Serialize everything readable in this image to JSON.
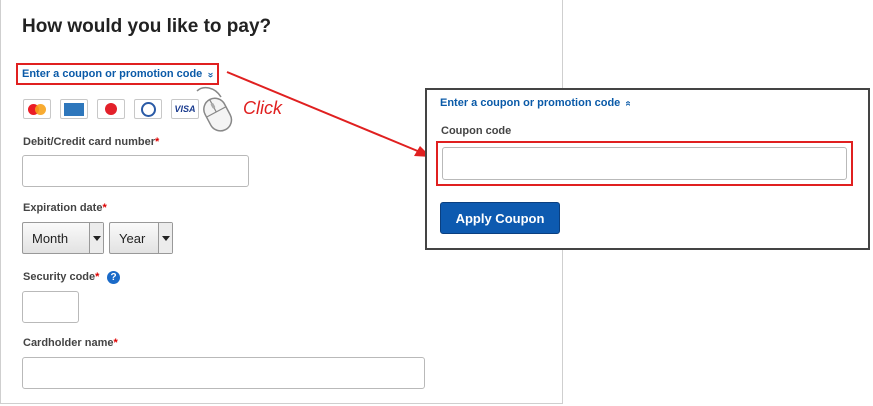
{
  "payment": {
    "title": "How would you like to pay?",
    "coupon_link": "Enter a coupon or promotion code",
    "coupon_chevron": "»",
    "card_icons": [
      "mastercard-icon",
      "amex-icon",
      "jcb-icon",
      "diners-club-icon",
      "visa-icon"
    ],
    "visa_text": "VISA",
    "card_number_label": "Debit/Credit card number",
    "expiration_label": "Expiration date",
    "month_value": "Month",
    "year_value": "Year",
    "security_label": "Security code",
    "help_glyph": "?",
    "cardholder_label": "Cardholder name",
    "required_mark": "*"
  },
  "annotation": {
    "click_text": "Click",
    "highlight_color": "#e02020"
  },
  "coupon_panel": {
    "link": "Enter a coupon or promotion code",
    "chevron": "»",
    "field_label": "Coupon code",
    "field_value": "",
    "apply_label": "Apply Coupon"
  },
  "colors": {
    "link": "#0a5aa8",
    "button": "#0d5ab0",
    "required": "#dd0000"
  }
}
